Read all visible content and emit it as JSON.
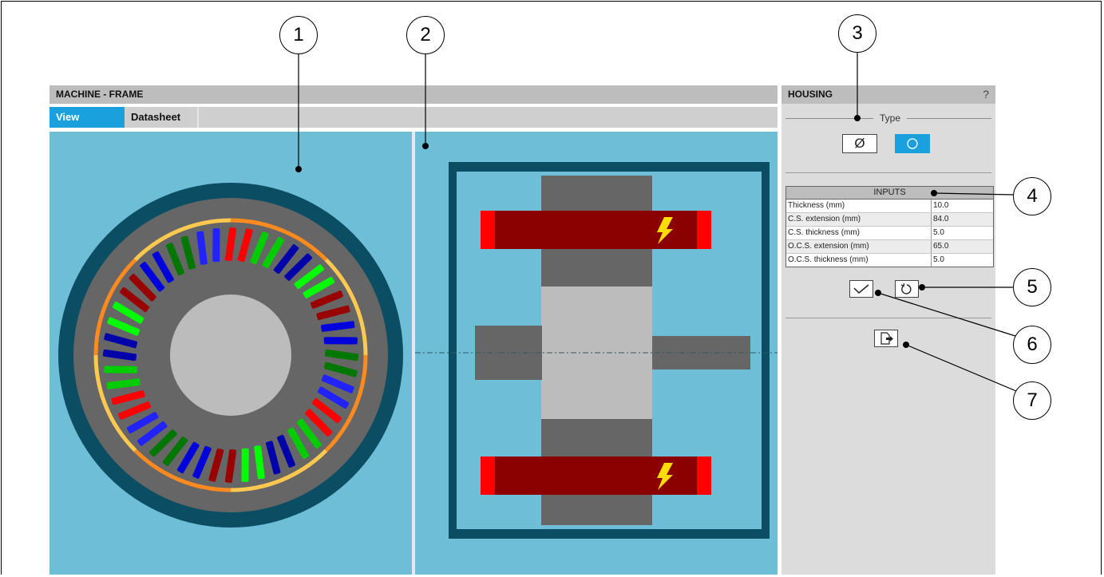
{
  "callouts": [
    "1",
    "2",
    "3",
    "4",
    "5",
    "6",
    "7"
  ],
  "main": {
    "title": "MACHINE - FRAME",
    "tabs": [
      {
        "label": "View",
        "active": true
      },
      {
        "label": "Datasheet",
        "active": false
      }
    ]
  },
  "housing": {
    "title": "HOUSING",
    "help": "?",
    "type_label": "Type",
    "type_options": [
      {
        "icon": "slashed-circle-icon",
        "symbol": "Ø",
        "selected": false
      },
      {
        "icon": "circle-icon",
        "selected": true
      }
    ],
    "inputs": {
      "title": "INPUTS",
      "rows": [
        {
          "label": "Thickness (mm)",
          "value": "10.0"
        },
        {
          "label": "C.S. extension (mm)",
          "value": "84.0"
        },
        {
          "label": "C.S. thickness (mm)",
          "value": "5.0"
        },
        {
          "label": "O.C.S. extension (mm)",
          "value": "65.0"
        },
        {
          "label": "O.C.S. thickness (mm)",
          "value": "5.0"
        }
      ]
    },
    "buttons": {
      "apply": "check-icon",
      "reset": "reset-icon",
      "export": "export-icon"
    }
  },
  "colors": {
    "panel_bg": "#6ebed8",
    "accent": "#1aa0dc",
    "housing": "#0b4d63",
    "stator": "#666666",
    "rotor": "#bcbcbc",
    "winding": "#8b0000",
    "winding_end": "#ff0000",
    "bolt": "#ffdd00",
    "phase_colors": [
      "#ff0000",
      "#00cc00",
      "#0000aa",
      "#00ff00",
      "#990000",
      "#0000dd",
      "#007700",
      "#2222ff"
    ]
  }
}
